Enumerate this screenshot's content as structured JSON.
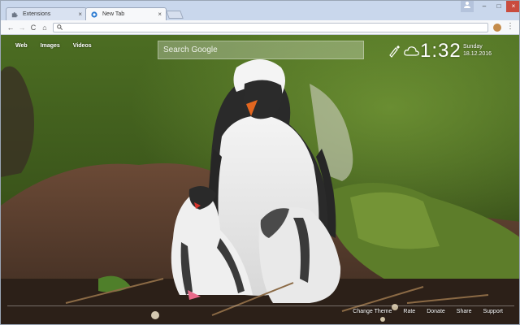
{
  "browser": {
    "tabs": [
      {
        "label": "Extensions",
        "icon": "puzzle-icon",
        "active": false
      },
      {
        "label": "New Tab",
        "icon": "new-tab-logo-icon",
        "active": true
      }
    ],
    "tab_close_glyph": "×",
    "window_controls": {
      "minimize": "–",
      "maximize": "□",
      "close": "×"
    },
    "nav": {
      "back": "←",
      "forward": "→",
      "reload": "C",
      "home": "⌂"
    },
    "omnibox": {
      "value": "",
      "search_glyph": "🔍"
    },
    "menu_glyph": "⋮"
  },
  "newtab": {
    "nav_links": [
      "Web",
      "Images",
      "Videos"
    ],
    "search_placeholder": "Search Google",
    "clock": "1:32",
    "day": "Sunday",
    "date": "18.12.2016",
    "footer_links": [
      "Change Theme",
      "Rate",
      "Donate",
      "Share",
      "Support"
    ]
  },
  "colors": {
    "tabstrip": "#c9d7ec",
    "toolbar": "#f7f8fa",
    "close_button": "#c94c3e",
    "grass": "#5b7a24",
    "soil": "#5a4030"
  }
}
